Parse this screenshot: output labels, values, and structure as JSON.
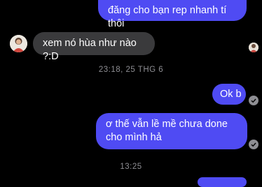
{
  "messages": [
    {
      "text": "đăng cho bạn rep nhanh tí thôi",
      "direction": "sent"
    },
    {
      "text": "xem nó hùa như nào ?:D",
      "direction": "received"
    },
    {
      "text": "Ok b",
      "direction": "sent"
    },
    {
      "text": "ơ thế vẫn lề mề chưa done cho mình hả",
      "direction": "sent"
    }
  ],
  "timestamps": [
    "23:18, 25 THG 6",
    "13:25"
  ],
  "colors": {
    "sent_bubble": "#4f4bf3",
    "received_bubble": "#3a3a3c",
    "background": "#000000",
    "timestamp": "#8e8e93"
  },
  "icons": {
    "avatar": "avatar-photo",
    "read_receipt": "check-circle-icon"
  }
}
